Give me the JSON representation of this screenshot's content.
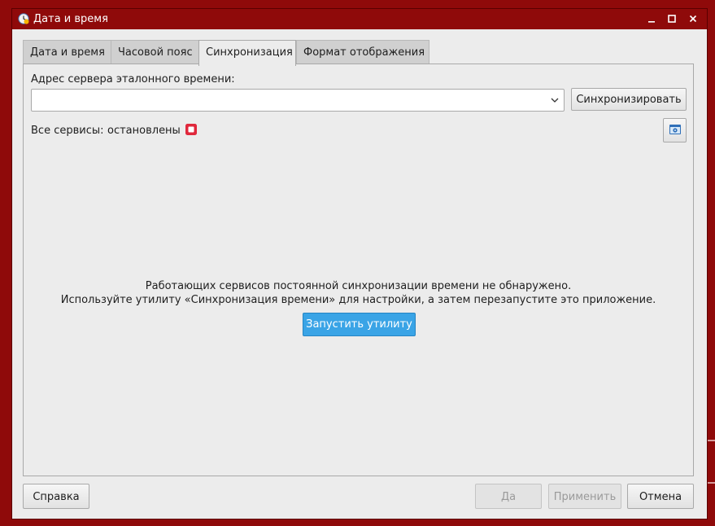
{
  "window": {
    "title": "Дата и время"
  },
  "tabs": [
    {
      "label": "Дата и время"
    },
    {
      "label": "Часовой пояс"
    },
    {
      "label": "Синхронизация",
      "active": true
    },
    {
      "label": "Формат отображения"
    }
  ],
  "sync": {
    "server_label": "Адрес сервера эталонного времени:",
    "server_value": "",
    "sync_button": "Синхронизировать",
    "status_label": "Все сервисы:",
    "status_value": "остановлены",
    "status_icon": "stopped-square-icon",
    "status_color": "#e0283c",
    "settings_icon": "settings-window-icon"
  },
  "message": {
    "line1": "Работающих сервисов постоянной синхронизации времени не обнаружено.",
    "line2": "Используйте утилиту «Синхронизация времени» для настройки, а затем перезапустите это приложение.",
    "run_button": "Запустить утилиту"
  },
  "footer": {
    "help": "Справка",
    "ok": "Да",
    "apply": "Применить",
    "cancel": "Отмена"
  },
  "colors": {
    "titlebar": "#8f0a0a",
    "accent_button": "#3aa4e6"
  }
}
